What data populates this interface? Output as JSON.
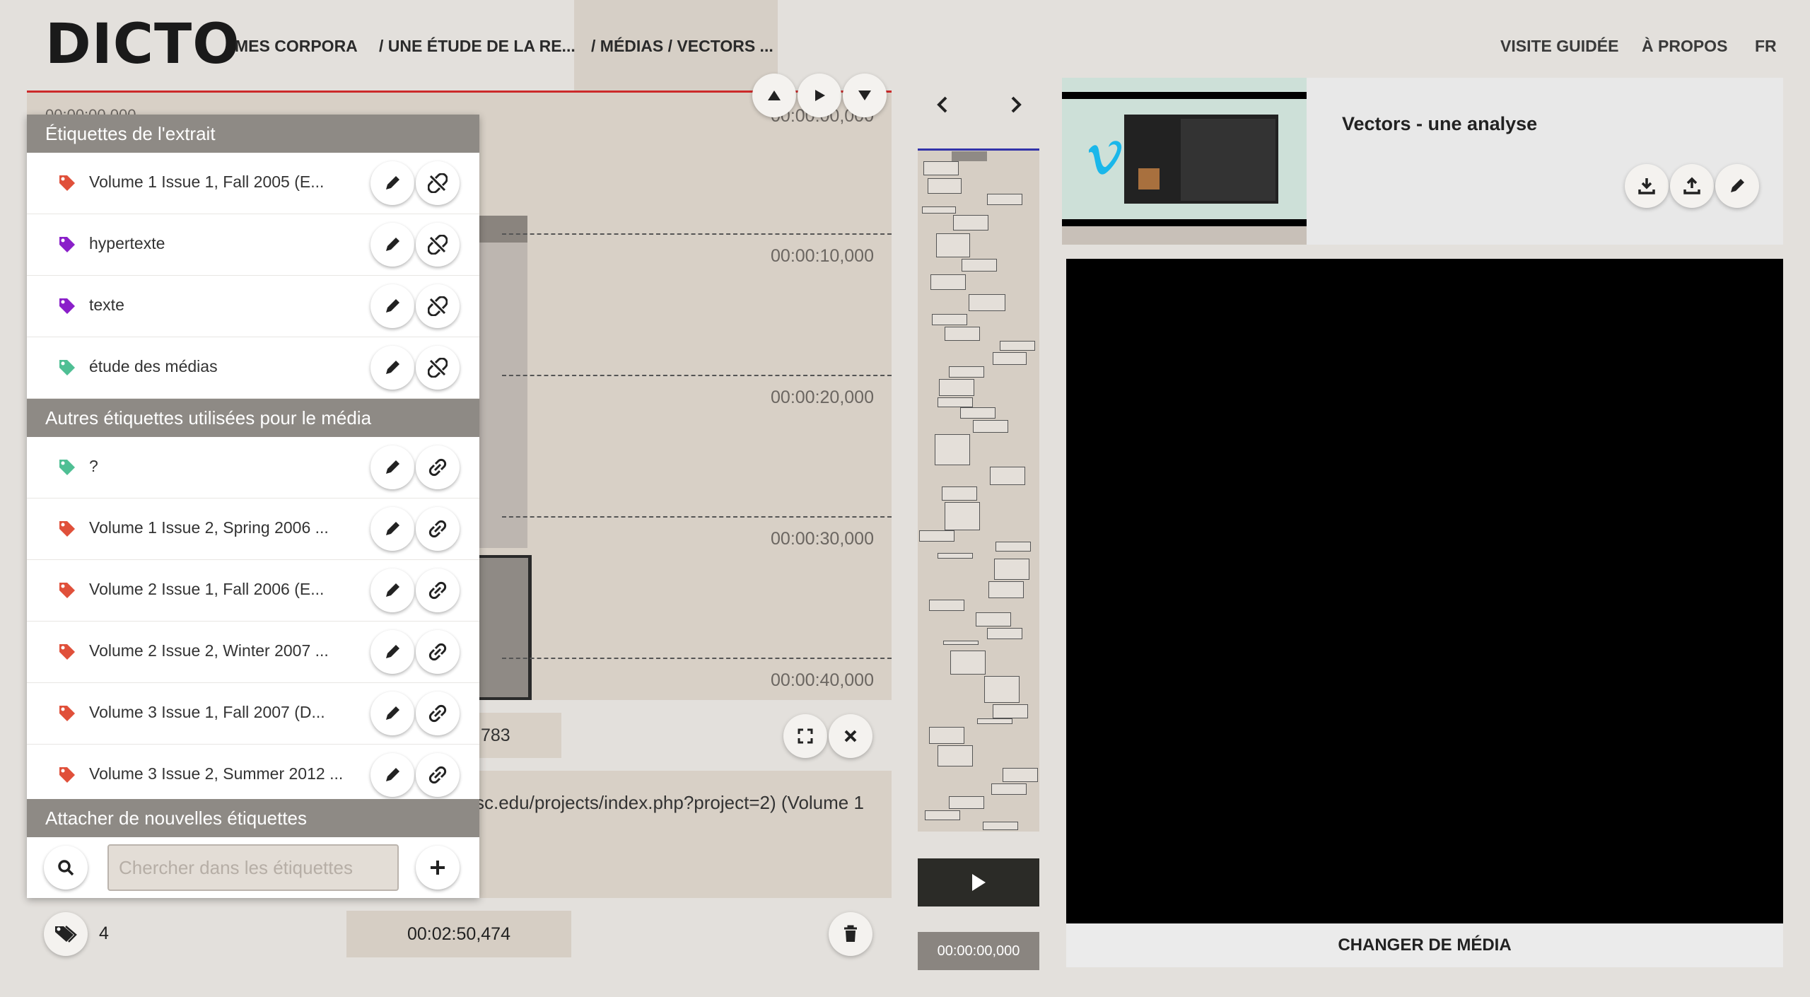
{
  "header": {
    "logo": "DICTO",
    "nav": [
      "MES CORPORA",
      "/ UNE ÉTUDE DE LA RE...",
      "/ MÉDIAS / VECTORS ..."
    ],
    "nav_right": [
      "VISITE GUIDÉE",
      "À PROPOS",
      "FR"
    ]
  },
  "timeline": {
    "times": [
      "00:00:00,000",
      "00:00:10,000",
      "00:00:20,000",
      "00:00:30,000",
      "00:00:40,000"
    ],
    "partial_id": "783",
    "desc_text": "sc.edu/projects/index.php?project=2) (Volume 1",
    "duration": "00:02:50,474",
    "tag_count": "4"
  },
  "tags_panel": {
    "section_current": "Étiquettes de l'extrait",
    "section_other": "Autres étiquettes utilisées pour le média",
    "section_new": "Attacher de nouvelles étiquettes",
    "current_tags": [
      {
        "label": "Volume 1 Issue 1, Fall 2005 (E...",
        "color": "#e0503a"
      },
      {
        "label": "hypertexte",
        "color": "#8a1fc9"
      },
      {
        "label": "texte",
        "color": "#8a1fc9"
      },
      {
        "label": "étude des médias",
        "color": "#4fbf94"
      }
    ],
    "other_tags": [
      {
        "label": "?",
        "color": "#4fbf94"
      },
      {
        "label": "Volume 1 Issue 2, Spring 2006 ...",
        "color": "#e0503a"
      },
      {
        "label": "Volume 2 Issue 1, Fall 2006 (E...",
        "color": "#e0503a"
      },
      {
        "label": "Volume 2 Issue 2, Winter 2007 ...",
        "color": "#e0503a"
      },
      {
        "label": "Volume 3 Issue 1, Fall 2007 (D...",
        "color": "#e0503a"
      },
      {
        "label": "Volume 3 Issue 2, Summer 2012 ...",
        "color": "#e0503a"
      }
    ],
    "search_placeholder": "Chercher dans les étiquettes"
  },
  "minimap": {
    "time": "00:00:00,000"
  },
  "media": {
    "title": "Vectors - une analyse",
    "change_label": "CHANGER DE MÉDIA"
  }
}
